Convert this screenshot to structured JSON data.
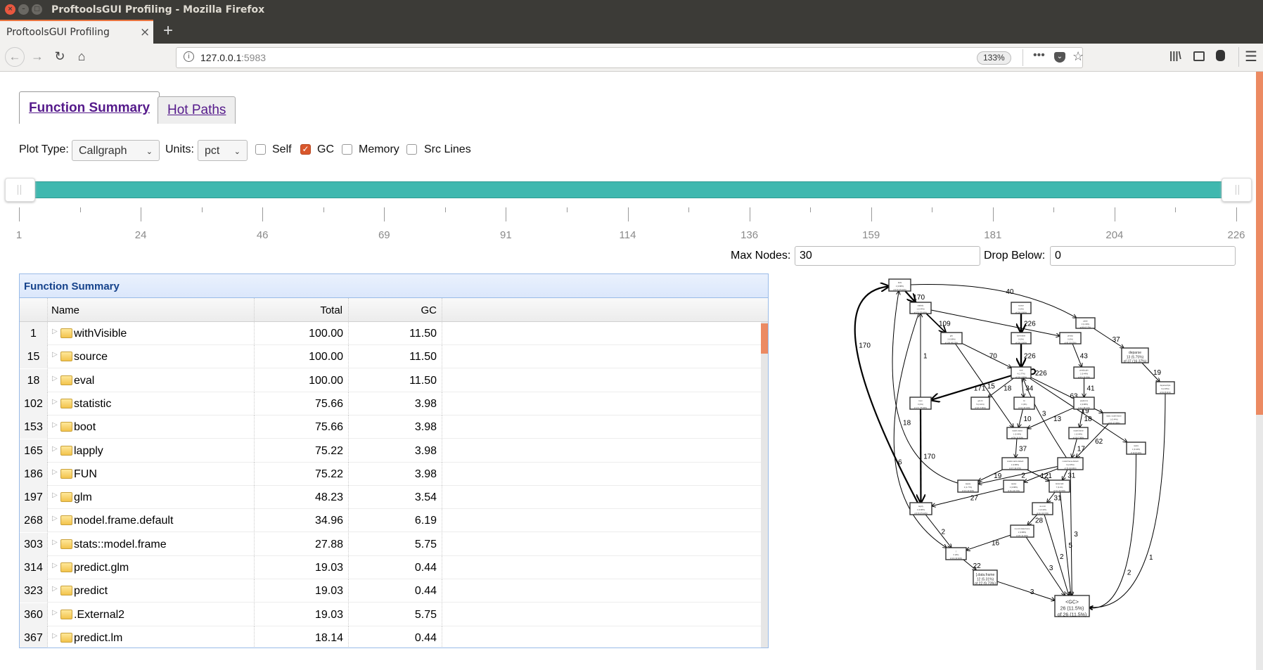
{
  "window": {
    "title": "ProftoolsGUI Profiling - Mozilla Firefox"
  },
  "browser": {
    "tab_title": "ProftoolsGUI Profiling",
    "url_host": "127.0.0.1",
    "url_port": ":5983",
    "zoom": "133%"
  },
  "tabs": [
    {
      "label": "Function Summary",
      "active": true
    },
    {
      "label": "Hot Paths",
      "active": false
    }
  ],
  "controls": {
    "plot_type_label": "Plot Type:",
    "plot_type": "Callgraph",
    "units_label": "Units:",
    "units": "pct",
    "self": {
      "label": "Self",
      "checked": false
    },
    "gc": {
      "label": "GC",
      "checked": true
    },
    "memory": {
      "label": "Memory",
      "checked": false
    },
    "src_lines": {
      "label": "Src Lines",
      "checked": false
    }
  },
  "slider": {
    "min": 1,
    "max": 226,
    "low": 1,
    "high": 226,
    "tick_labels": [
      "1",
      "24",
      "46",
      "69",
      "91",
      "114",
      "136",
      "159",
      "181",
      "204",
      "226"
    ],
    "color": "#3fb8af"
  },
  "max_nodes": {
    "label": "Max Nodes:",
    "value": "30"
  },
  "drop_below": {
    "label": "Drop Below:",
    "value": "0"
  },
  "grid": {
    "title": "Function Summary",
    "columns": [
      "Name",
      "Total",
      "GC"
    ],
    "rows": [
      {
        "id": "1",
        "name": "withVisible",
        "total": "100.00",
        "gc": "11.50"
      },
      {
        "id": "15",
        "name": "source",
        "total": "100.00",
        "gc": "11.50"
      },
      {
        "id": "18",
        "name": "eval",
        "total": "100.00",
        "gc": "11.50"
      },
      {
        "id": "102",
        "name": "statistic",
        "total": "75.66",
        "gc": "3.98"
      },
      {
        "id": "153",
        "name": "boot",
        "total": "75.66",
        "gc": "3.98"
      },
      {
        "id": "165",
        "name": "lapply",
        "total": "75.22",
        "gc": "3.98"
      },
      {
        "id": "186",
        "name": "FUN",
        "total": "75.22",
        "gc": "3.98"
      },
      {
        "id": "197",
        "name": "glm",
        "total": "48.23",
        "gc": "3.54"
      },
      {
        "id": "268",
        "name": "model.frame.default",
        "total": "34.96",
        "gc": "6.19"
      },
      {
        "id": "303",
        "name": "stats::model.frame",
        "total": "27.88",
        "gc": "5.75"
      },
      {
        "id": "314",
        "name": "predict.glm",
        "total": "19.03",
        "gc": "0.44"
      },
      {
        "id": "323",
        "name": "predict",
        "total": "19.03",
        "gc": "0.44"
      },
      {
        "id": "360",
        "name": ".External2",
        "total": "19.03",
        "gc": "5.75"
      },
      {
        "id": "367",
        "name": "predict.lm",
        "total": "18.14",
        "gc": "0.44"
      }
    ]
  },
  "callgraph": {
    "nodes": [
      {
        "id": "FUN",
        "name": "FUN",
        "l2": "2 (0.88%)",
        "l3": "of 170 (75.22%)"
      },
      {
        "id": "statistic",
        "name": "statistic",
        "l2": "1 (0.44%)",
        "l3": "of 171 (75.66%)"
      },
      {
        "id": "source",
        "name": "source",
        "l2": "0 (0%)",
        "l3": "of 226 (100%)"
      },
      {
        "id": "paste",
        "name": "paste",
        "l2": "3 (1.33%)",
        "l3": "of 40 (17.7%)"
      },
      {
        "id": "glm",
        "name": "glm",
        "l2": "2 (0.88%)",
        "l3": "of 109 (48.23%)"
      },
      {
        "id": "withVisible",
        "name": "withVisible",
        "l2": "0 (0%)",
        "l3": "of 226 (100%)"
      },
      {
        "id": "predict",
        "name": "predict",
        "l2": "0 (0%)",
        "l3": "of 43 (19.03%)"
      },
      {
        "id": "deparse",
        "name": "deparse",
        "l2": "13 (5.75%)",
        "l3": "of 37 (16.37%)",
        "big": true
      },
      {
        "id": "eval",
        "name": "eval",
        "l2": "4 (1.77%)",
        "l3": "of 226 (100%)"
      },
      {
        "id": "predict.glm",
        "name": "predict.glm",
        "l2": "1 (0.44%)",
        "l3": "of 43 (19.03%)"
      },
      {
        "id": "deparseOpts",
        "name": "deparseOpts",
        "l2": "6 (2.65%)",
        "l3": "of 19 (8.41%)"
      },
      {
        "id": "boot",
        "name": "boot",
        "l2": "0 (0%)",
        "l3": "of 171 (75.66%)"
      },
      {
        "id": "glm.fit",
        "name": "glm.fit",
        "l2": "5 (2.21%)",
        "l3": "of 18 (7.96%)"
      },
      {
        "id": "lm",
        "name": "lm",
        "l2": "0 (0%)",
        "l3": "of 34 (15.04%)"
      },
      {
        "id": "predict.lm",
        "name": "predict.lm",
        "l2": "2 (0.88%)",
        "l3": "of 41 (18.14%)"
      },
      {
        "id": "stats::model.frame",
        "name": "stats::model.frame",
        "l2": "1 (0.44%)",
        "l3": "of 63 (27.88%)"
      },
      {
        "id": "model.matrix",
        "name": "model.matrix",
        "l2": "1 (0.44%)",
        "l3": "of 38 (16.81%)"
      },
      {
        "id": "model.frame",
        "name": "model.frame",
        "l2": "1 (0.44%)",
        "l3": "of 18 (7.96%)"
      },
      {
        "id": "matrix",
        "name": "matrix",
        "l2": "1 (0.44%)",
        "l3": "of 19 (8.41%)"
      },
      {
        "id": "model.matrix.default",
        "name": "model.matrix.default",
        "l2": "2 (0.88%)",
        "l3": "of 37 (16.37%)"
      },
      {
        "id": "model.frame.default",
        "name": "model.frame.default",
        "l2": "6 (2.65%)",
        "l3": "of 79 (34.96%)"
      },
      {
        "id": "sapply",
        "name": "sapply",
        "l2": "4 (1.77%)",
        "l3": "of 24 (10.62%)"
      },
      {
        "id": "vapply",
        "name": "vapply",
        "l2": "2 (0.88%)",
        "l3": "of 31 (13.72%)"
      },
      {
        "id": ".External2",
        "name": ".External2",
        "l2": "7 (3.1%)",
        "l3": "of 43 (19.03%)"
      },
      {
        "id": "lapply",
        "name": "lapply",
        "l2": "2 (0.88%)",
        "l3": "of 170 (75.22%)"
      },
      {
        "id": "na.omit",
        "name": "na.omit",
        "l2": "1 (0.44%)",
        "l3": "of 31 (13.72%)"
      },
      {
        "id": "na.omit.data.frame",
        "name": "na.omit.data.frame",
        "l2": "2 (0.88%)",
        "l3": "of 28 (12.39%)"
      },
      {
        "id": "[",
        "name": "[",
        "l2": "0 (0%)",
        "l3": "of 24 (10.62%)"
      },
      {
        "id": "[.data.frame",
        "name": "[.data.frame",
        "l2": "12 (5.31%)",
        "l3": "of 22 (9.73%)",
        "big": true
      },
      {
        "id": "<GC>",
        "name": "<GC>",
        "l2": "26 (11.5%)",
        "l3": "of 26 (11.5%)",
        "big": true
      }
    ],
    "edges": [
      {
        "from": "FUN",
        "to": "statistic",
        "label": "170"
      },
      {
        "from": "FUN",
        "to": "paste",
        "label": "40"
      },
      {
        "from": "source",
        "to": "withVisible",
        "label": "226"
      },
      {
        "from": "statistic",
        "to": "glm",
        "label": "109"
      },
      {
        "from": "statistic",
        "to": "predict",
        "label": ""
      },
      {
        "from": "withVisible",
        "to": "eval",
        "label": "226"
      },
      {
        "from": "glm",
        "to": "eval",
        "label": "70"
      },
      {
        "from": "predict",
        "to": "predict.glm",
        "label": "43"
      },
      {
        "from": "paste",
        "to": "deparse",
        "label": "37"
      },
      {
        "from": "deparse",
        "to": "deparseOpts",
        "label": "19"
      },
      {
        "from": "eval",
        "to": "boot",
        "label": "171"
      },
      {
        "from": "eval",
        "to": "glm.fit",
        "label": "18"
      },
      {
        "from": "eval",
        "to": "lm",
        "label": "34"
      },
      {
        "from": "eval",
        "to": "stats::model.frame",
        "label": "63"
      },
      {
        "from": "eval",
        "to": "matrix",
        "label": "19"
      },
      {
        "from": "predict.glm",
        "to": "predict.lm",
        "label": "41"
      },
      {
        "from": "boot",
        "to": "statistic",
        "label": "1"
      },
      {
        "from": "glm",
        "to": "model.matrix",
        "label": "15"
      },
      {
        "from": "lm",
        "to": "model.matrix",
        "label": "10"
      },
      {
        "from": "predict.lm",
        "to": "model.matrix",
        "label": "13"
      },
      {
        "from": "predict.lm",
        "to": "model.frame",
        "label": "18"
      },
      {
        "from": "stats::model.frame",
        "to": "model.frame.default",
        "label": "62"
      },
      {
        "from": "model.frame",
        "to": "model.frame.default",
        "label": "17"
      },
      {
        "from": "model.frame.default",
        "to": "eval",
        "label": "3"
      },
      {
        "from": "model.matrix",
        "to": "model.matrix.default",
        "label": "37"
      },
      {
        "from": "model.matrix.default",
        "to": "sapply",
        "label": "19"
      },
      {
        "from": "model.matrix.default",
        "to": ".External2",
        "label": "12"
      },
      {
        "from": "model.frame.default",
        "to": "sapply",
        "label": "2"
      },
      {
        "from": "model.frame.default",
        "to": "vapply",
        "label": "21"
      },
      {
        "from": "model.frame.default",
        "to": ".External2",
        "label": "31"
      },
      {
        "from": ".External2",
        "to": "na.omit",
        "label": "31"
      },
      {
        "from": "na.omit",
        "to": "na.omit.data.frame",
        "label": "28"
      },
      {
        "from": "sapply",
        "to": "FUN",
        "label": "18"
      },
      {
        "from": "vapply",
        "to": "lapply",
        "label": "27"
      },
      {
        "from": "boot",
        "to": "lapply",
        "label": "170"
      },
      {
        "from": "lapply",
        "to": "FUN",
        "label": "170"
      },
      {
        "from": "statistic",
        "to": "[",
        "label": "6"
      },
      {
        "from": "lapply",
        "to": "[",
        "label": "2"
      },
      {
        "from": "na.omit.data.frame",
        "to": "[",
        "label": "16"
      },
      {
        "from": "[",
        "to": "[.data.frame",
        "label": "22"
      },
      {
        "from": "[.data.frame",
        "to": "<GC>",
        "label": "3"
      },
      {
        "from": "na.omit.data.frame",
        "to": "<GC>",
        "label": "3"
      },
      {
        "from": "na.omit",
        "to": "<GC>",
        "label": "2"
      },
      {
        "from": ".External2",
        "to": "<GC>",
        "label": "5"
      },
      {
        "from": "model.frame.default",
        "to": "<GC>",
        "label": "3"
      },
      {
        "from": "matrix",
        "to": "<GC>",
        "label": "2"
      },
      {
        "from": "deparseOpts",
        "to": "<GC>",
        "label": "1"
      }
    ],
    "self_loop": {
      "node": "eval",
      "label": "226"
    }
  }
}
